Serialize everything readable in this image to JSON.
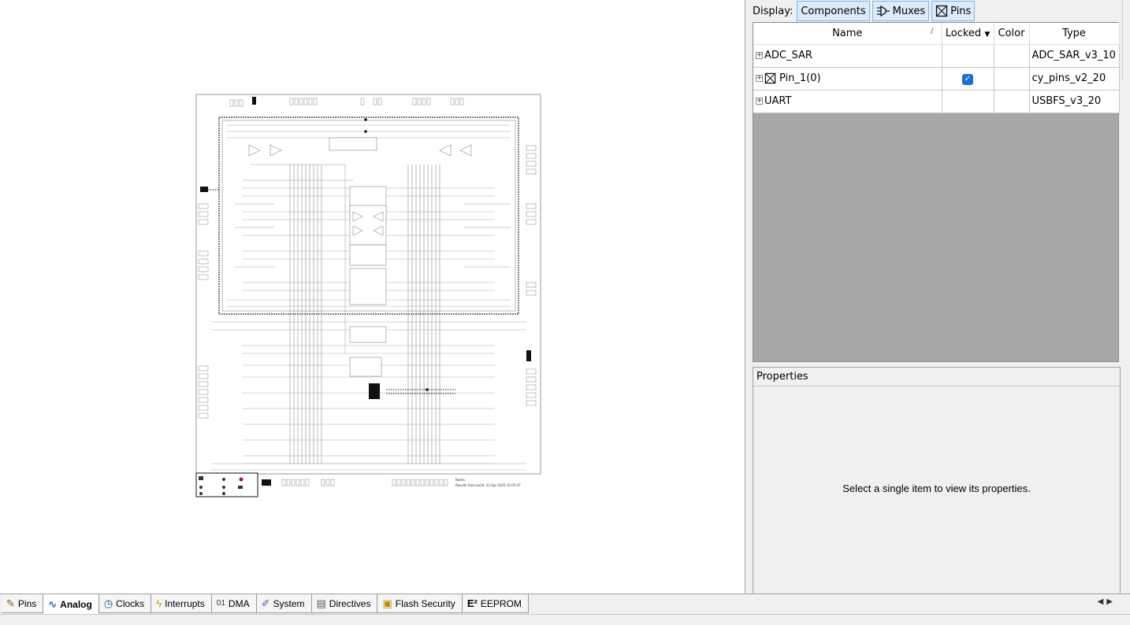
{
  "toolbar": {
    "display_label": "Display:",
    "buttons": [
      {
        "label": "Components",
        "icon": "none"
      },
      {
        "label": "Muxes",
        "icon": "mux-icon"
      },
      {
        "label": "Pins",
        "icon": "pin-box-icon"
      }
    ]
  },
  "table": {
    "headers": [
      "Name",
      "Locked",
      "Color",
      "Type"
    ],
    "rows": [
      {
        "name": "ADC_SAR",
        "locked": false,
        "color": "",
        "type": "ADC_SAR_v3_10",
        "pin_icon": false
      },
      {
        "name": "Pin_1(0)",
        "locked": true,
        "color": "",
        "type": "cy_pins_v2_20",
        "pin_icon": true
      },
      {
        "name": "UART",
        "locked": false,
        "color": "",
        "type": "USBFS_v3_20",
        "pin_icon": false
      }
    ]
  },
  "properties": {
    "title": "Properties",
    "message": "Select a single item to view its properties."
  },
  "schematic": {
    "notes_label": "Notes:",
    "build_text": "Results from build: 23 Apr 2025 15:05:37"
  },
  "tabs": [
    {
      "label": "Pins",
      "icon": "pins-icon",
      "active": false
    },
    {
      "label": "Analog",
      "icon": "analog-wave-icon",
      "active": true
    },
    {
      "label": "Clocks",
      "icon": "clock-icon",
      "active": false
    },
    {
      "label": "Interrupts",
      "icon": "lightning-icon",
      "active": false
    },
    {
      "label": "DMA",
      "icon": "dma-icon",
      "active": false
    },
    {
      "label": "System",
      "icon": "system-icon",
      "active": false
    },
    {
      "label": "Directives",
      "icon": "directives-icon",
      "active": false
    },
    {
      "label": "Flash Security",
      "icon": "flash-security-icon",
      "active": false
    },
    {
      "label": "EEPROM",
      "icon": "eeprom-icon",
      "active": false
    }
  ],
  "colors": {
    "accent": "#1f6fd1",
    "table_bg": "#a8a8a8",
    "tab_active": "#ffffff"
  }
}
